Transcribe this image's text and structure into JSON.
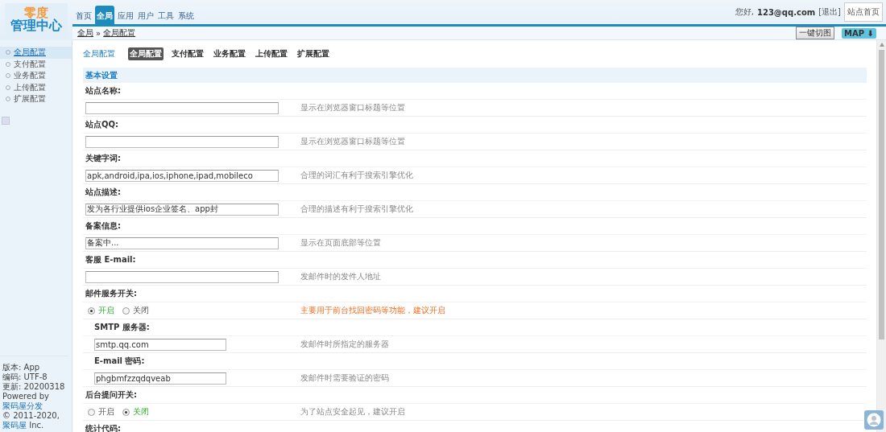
{
  "logo": {
    "top": "零度",
    "bottom": "管理中心"
  },
  "nav": [
    {
      "label": "首页",
      "selected": false
    },
    {
      "label": "全局",
      "selected": true
    },
    {
      "label": "应用",
      "selected": false
    },
    {
      "label": "用户",
      "selected": false
    },
    {
      "label": "工具",
      "selected": false
    },
    {
      "label": "系统",
      "selected": false
    }
  ],
  "user": {
    "greeting": "您好,",
    "email": "123@qq.com",
    "logout": "[退出]",
    "home": "站点首页"
  },
  "breadcrumb": {
    "root": "全局",
    "separator": "»",
    "current": "全局配置"
  },
  "toolbar": {
    "cut": "一键切图",
    "map": "MAP ⬇"
  },
  "sidebar": {
    "items": [
      {
        "label": "全局配置",
        "selected": true
      },
      {
        "label": "支付配置",
        "selected": false
      },
      {
        "label": "业务配置",
        "selected": false
      },
      {
        "label": "上传配置",
        "selected": false
      },
      {
        "label": "扩展配置",
        "selected": false
      }
    ],
    "footer": {
      "version": "版本: App",
      "charset": "编码: UTF-8",
      "updated": "更新: 20200318",
      "powered": "Powered by",
      "powered_link": "聚码屋分发",
      "copyright": "© 2011-2020,",
      "copyright_link": "聚码屋",
      "copyright_tail": "Inc."
    }
  },
  "page_title": "全局配置",
  "subtabs": [
    {
      "label": "全局配置",
      "selected": true
    },
    {
      "label": "支付配置",
      "selected": false
    },
    {
      "label": "业务配置",
      "selected": false
    },
    {
      "label": "上传配置",
      "selected": false
    },
    {
      "label": "扩展配置",
      "selected": false
    }
  ],
  "section": "基本设置",
  "fields": [
    {
      "kind": "text",
      "label": "站点名称:",
      "sub": false,
      "hint": "显示在浏览器窗口标题等位置",
      "hint_warning": false
    },
    {
      "kind": "text",
      "label": "站点QQ:",
      "sub": false,
      "hint": "显示在浏览器窗口标题等位置",
      "hint_warning": false
    },
    {
      "kind": "text",
      "label": "关键字词:",
      "value": "apk,android,ipa,ios,iphone,ipad,mobileco",
      "sub": false,
      "hint": "合理的词汇有利于搜索引擎优化",
      "hint_warning": false
    },
    {
      "kind": "text",
      "label": "站点描述:",
      "value": "发为各行业提供ios企业签名、app封",
      "sub": false,
      "hint": "合理的描述有利于搜索引擎优化",
      "hint_warning": false
    },
    {
      "kind": "text",
      "label": "备案信息:",
      "value": "备案中...",
      "sub": false,
      "hint": "显示在页面底部等位置",
      "hint_warning": false
    },
    {
      "kind": "text",
      "label": "客服 E-mail:",
      "sub": false,
      "hint": "发邮件时的发件人地址",
      "hint_warning": false
    },
    {
      "kind": "radio",
      "label": "邮件服务开关:",
      "sub": false,
      "options": [
        {
          "label": "开启",
          "selected": true
        },
        {
          "label": "关闭",
          "selected": false
        }
      ],
      "hint": "主要用于前台找回密码等功能，建议开启",
      "hint_warning": true
    },
    {
      "kind": "text",
      "label": "SMTP 服务器:",
      "value": "smtp.qq.com",
      "sub": true,
      "hint": "发邮件时所指定的服务器",
      "hint_warning": false
    },
    {
      "kind": "text",
      "label": "E-mail 密码:",
      "value": "phgbmfzzqdqveab",
      "sub": true,
      "hint": "发邮件时需要验证的密码",
      "hint_warning": false
    },
    {
      "kind": "radio",
      "label": "后台提问开关:",
      "sub": false,
      "options": [
        {
          "label": "开启",
          "selected": false
        },
        {
          "label": "关闭",
          "selected": true
        }
      ],
      "hint": "为了站点安全起见，建议开启",
      "hint_warning": false
    },
    {
      "kind": "label",
      "label": "统计代码:",
      "sub": false
    }
  ]
}
